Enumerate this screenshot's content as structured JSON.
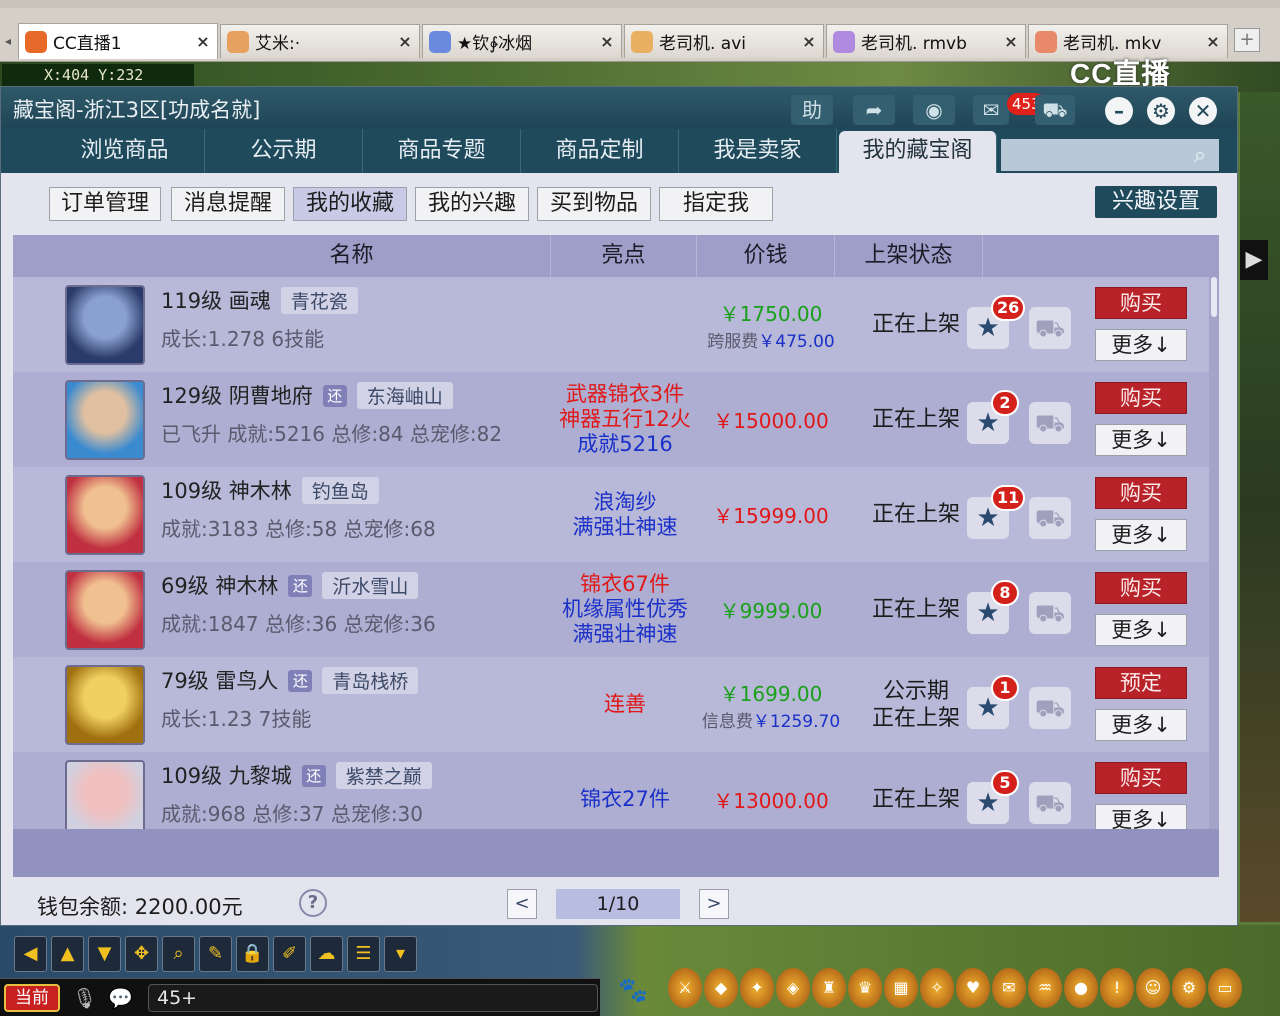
{
  "browser": {
    "tabs": [
      {
        "label": "CC直播1",
        "icon_color": "#e86a2a",
        "active": true
      },
      {
        "label": "艾米:·",
        "icon_color": "#e8a060",
        "active": false
      },
      {
        "label": "★钦∲冰烟",
        "icon_color": "#6a8ae0",
        "active": false
      },
      {
        "label": "老司机. avi",
        "icon_color": "#e8b060",
        "active": false
      },
      {
        "label": "老司机. rmvb",
        "icon_color": "#b08ae0",
        "active": false
      },
      {
        "label": "老司机. mkv",
        "icon_color": "#e88a6a",
        "active": false
      }
    ],
    "new_tab": "+"
  },
  "game": {
    "coords": "X:404 Y:232",
    "logo": "CC直播",
    "chat_channel_label": "当前",
    "chat_input_value": "45+"
  },
  "window": {
    "title": "藏宝阁-浙江3区[功成名就]",
    "help_label": "助",
    "message_count": "453"
  },
  "nav": {
    "tabs": [
      "浏览商品",
      "公示期",
      "商品专题",
      "商品定制",
      "我是卖家",
      "我的藏宝阁"
    ],
    "active_index": 5,
    "search_placeholder": ""
  },
  "subtabs": {
    "items": [
      "订单管理",
      "消息提醒",
      "我的收藏",
      "我的兴趣",
      "买到物品",
      "指定我"
    ],
    "active_index": 2,
    "interest_settings": "兴趣设置"
  },
  "table": {
    "headers": [
      "名称",
      "亮点",
      "价钱",
      "上架状态"
    ],
    "buy_label": "购买",
    "more_label": "更多",
    "rows": [
      {
        "name": "119级 画魂",
        "return_tag": "",
        "server": "青花瓷",
        "stats": "成长:1.278 6技能",
        "highlights": [],
        "price": "￥1750.00",
        "price_color": "green",
        "fee": "跨服费",
        "fee_amount": "￥475.00",
        "status": [
          "正在上架"
        ],
        "fav_count": "26",
        "buy_label": "购买",
        "avatar_colors": [
          "#2a3a6a",
          "#8aa0d0"
        ]
      },
      {
        "name": "129级 阴曹地府",
        "return_tag": "还",
        "server": "东海岫山",
        "stats": "已飞升 成就:5216 总修:84 总宠修:82",
        "highlights": [
          {
            "text": "武器锦衣3件",
            "color": "red"
          },
          {
            "text": "神器五行12火",
            "color": "red"
          },
          {
            "text": "成就5216",
            "color": "blue"
          }
        ],
        "price": "￥15000.00",
        "price_color": "red",
        "fee": "",
        "fee_amount": "",
        "status": [
          "正在上架"
        ],
        "fav_count": "2",
        "buy_label": "购买",
        "avatar_colors": [
          "#3a8ad0",
          "#e0c0a0"
        ]
      },
      {
        "name": "109级 神木林",
        "return_tag": "",
        "server": "钓鱼岛",
        "stats": "成就:3183 总修:58 总宠修:68",
        "highlights": [
          {
            "text": "浪淘纱",
            "color": "blue"
          },
          {
            "text": "满强壮神速",
            "color": "blue"
          }
        ],
        "price": "￥15999.00",
        "price_color": "red",
        "fee": "",
        "fee_amount": "",
        "status": [
          "正在上架"
        ],
        "fav_count": "11",
        "buy_label": "购买",
        "avatar_colors": [
          "#c03040",
          "#f0c090"
        ]
      },
      {
        "name": "69级 神木林",
        "return_tag": "还",
        "server": "沂水雪山",
        "stats": "成就:1847 总修:36 总宠修:36",
        "highlights": [
          {
            "text": "锦衣67件",
            "color": "red"
          },
          {
            "text": "机缘属性优秀",
            "color": "blue"
          },
          {
            "text": "满强壮神速",
            "color": "blue"
          }
        ],
        "price": "￥9999.00",
        "price_color": "green",
        "fee": "",
        "fee_amount": "",
        "status": [
          "正在上架"
        ],
        "fav_count": "8",
        "buy_label": "购买",
        "avatar_colors": [
          "#c03040",
          "#f0c090"
        ]
      },
      {
        "name": "79级 雷鸟人",
        "return_tag": "还",
        "server": "青岛栈桥",
        "stats": "成长:1.23 7技能",
        "highlights": [
          {
            "text": "连善",
            "color": "red"
          }
        ],
        "price": "￥1699.00",
        "price_color": "green",
        "fee": "信息费",
        "fee_amount": "￥1259.70",
        "status": [
          "公示期",
          "正在上架"
        ],
        "fav_count": "1",
        "buy_label": "预定",
        "avatar_colors": [
          "#a07010",
          "#f0d060"
        ]
      },
      {
        "name": "109级 九黎城",
        "return_tag": "还",
        "server": "紫禁之巅",
        "stats": "成就:968 总修:37 总宠修:30",
        "highlights": [
          {
            "text": "锦衣27件",
            "color": "blue"
          }
        ],
        "price": "￥13000.00",
        "price_color": "red",
        "fee": "",
        "fee_amount": "",
        "status": [
          "正在上架"
        ],
        "fav_count": "5",
        "buy_label": "购买",
        "avatar_colors": [
          "#d0d0e0",
          "#f0c0c0"
        ]
      }
    ]
  },
  "footer": {
    "wallet": "钱包余额: 2200.00元",
    "page": "1/10"
  },
  "colors": {
    "titlebar": "#24495a",
    "buy_button": "#b8232a",
    "price_green": "#1aa01a",
    "price_red": "#e01818",
    "highlight_blue": "#1a30c8"
  }
}
